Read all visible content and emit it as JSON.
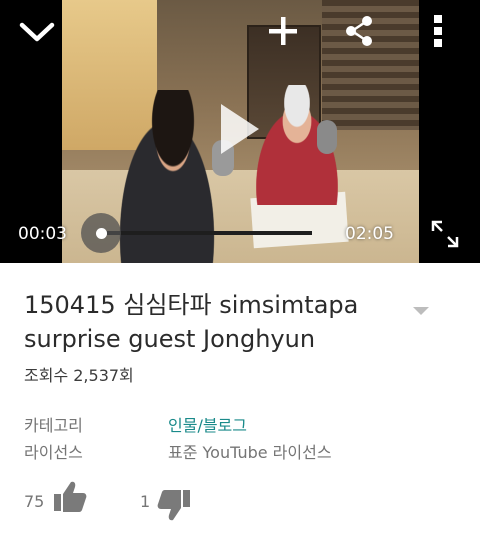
{
  "player": {
    "current_time": "00:03",
    "duration": "02:05",
    "progress": 0.024,
    "icons": {
      "collapse": "chevron-down-icon",
      "add": "plus-icon",
      "share": "share-icon",
      "menu": "more-vert-icon",
      "play": "play-icon",
      "fullscreen": "fullscreen-icon"
    }
  },
  "video": {
    "title": "150415 심심타파 simsimtapa surprise guest Jonghyun",
    "views": "조회수 2,537회",
    "category_label": "카테고리",
    "category_value": "인물/블로그",
    "license_label": "라이선스",
    "license_value": "표준 YouTube 라이선스",
    "likes": "75",
    "dislikes": "1"
  },
  "colors": {
    "link": "#1a8a8a",
    "icon_gray": "#7a7a7a",
    "title": "#2b2b2b"
  }
}
